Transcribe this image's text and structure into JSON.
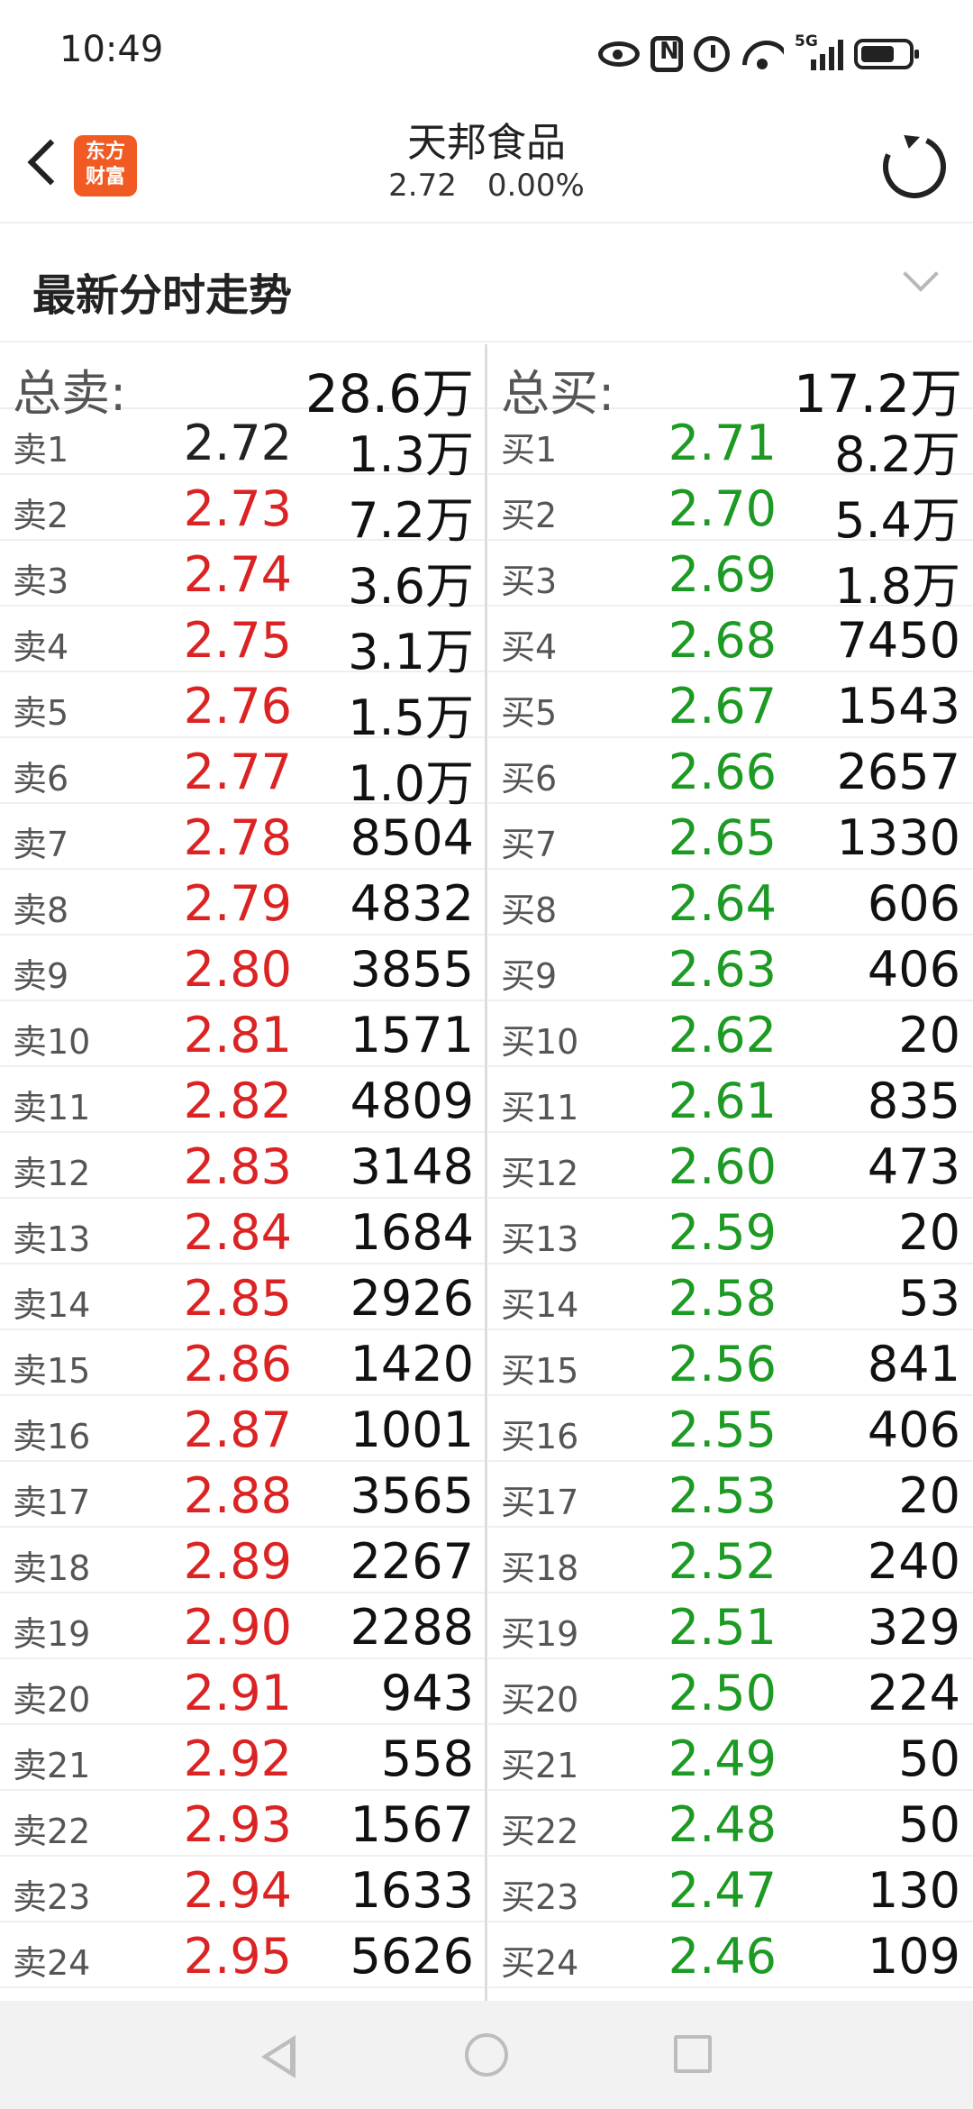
{
  "status_bar": {
    "time": "10:49",
    "network": "5G",
    "icons": [
      "eye-icon",
      "nfc-icon",
      "alarm-icon",
      "wifi-icon",
      "signal-icon",
      "battery-icon"
    ]
  },
  "header": {
    "app_logo_line1": "东方",
    "app_logo_line2": "财富",
    "stock_name": "天邦食品",
    "price": "2.72",
    "change_pct": "0.00%"
  },
  "section": {
    "title": "最新分时走势"
  },
  "order_book": {
    "sell_total_label": "总卖:",
    "sell_total": "28.6万",
    "buy_total_label": "总买:",
    "buy_total": "17.2万",
    "sell": [
      {
        "level": "卖1",
        "price": "2.72",
        "volume": "1.3万"
      },
      {
        "level": "卖2",
        "price": "2.73",
        "volume": "7.2万"
      },
      {
        "level": "卖3",
        "price": "2.74",
        "volume": "3.6万"
      },
      {
        "level": "卖4",
        "price": "2.75",
        "volume": "3.1万"
      },
      {
        "level": "卖5",
        "price": "2.76",
        "volume": "1.5万"
      },
      {
        "level": "卖6",
        "price": "2.77",
        "volume": "1.0万"
      },
      {
        "level": "卖7",
        "price": "2.78",
        "volume": "8504"
      },
      {
        "level": "卖8",
        "price": "2.79",
        "volume": "4832"
      },
      {
        "level": "卖9",
        "price": "2.80",
        "volume": "3855"
      },
      {
        "level": "卖10",
        "price": "2.81",
        "volume": "1571"
      },
      {
        "level": "卖11",
        "price": "2.82",
        "volume": "4809"
      },
      {
        "level": "卖12",
        "price": "2.83",
        "volume": "3148"
      },
      {
        "level": "卖13",
        "price": "2.84",
        "volume": "1684"
      },
      {
        "level": "卖14",
        "price": "2.85",
        "volume": "2926"
      },
      {
        "level": "卖15",
        "price": "2.86",
        "volume": "1420"
      },
      {
        "level": "卖16",
        "price": "2.87",
        "volume": "1001"
      },
      {
        "level": "卖17",
        "price": "2.88",
        "volume": "3565"
      },
      {
        "level": "卖18",
        "price": "2.89",
        "volume": "2267"
      },
      {
        "level": "卖19",
        "price": "2.90",
        "volume": "2288"
      },
      {
        "level": "卖20",
        "price": "2.91",
        "volume": "943"
      },
      {
        "level": "卖21",
        "price": "2.92",
        "volume": "558"
      },
      {
        "level": "卖22",
        "price": "2.93",
        "volume": "1567"
      },
      {
        "level": "卖23",
        "price": "2.94",
        "volume": "1633"
      },
      {
        "level": "卖24",
        "price": "2.95",
        "volume": "5626"
      }
    ],
    "buy": [
      {
        "level": "买1",
        "price": "2.71",
        "volume": "8.2万"
      },
      {
        "level": "买2",
        "price": "2.70",
        "volume": "5.4万"
      },
      {
        "level": "买3",
        "price": "2.69",
        "volume": "1.8万"
      },
      {
        "level": "买4",
        "price": "2.68",
        "volume": "7450"
      },
      {
        "level": "买5",
        "price": "2.67",
        "volume": "1543"
      },
      {
        "level": "买6",
        "price": "2.66",
        "volume": "2657"
      },
      {
        "level": "买7",
        "price": "2.65",
        "volume": "1330"
      },
      {
        "level": "买8",
        "price": "2.64",
        "volume": "606"
      },
      {
        "level": "买9",
        "price": "2.63",
        "volume": "406"
      },
      {
        "level": "买10",
        "price": "2.62",
        "volume": "20"
      },
      {
        "level": "买11",
        "price": "2.61",
        "volume": "835"
      },
      {
        "level": "买12",
        "price": "2.60",
        "volume": "473"
      },
      {
        "level": "买13",
        "price": "2.59",
        "volume": "20"
      },
      {
        "level": "买14",
        "price": "2.58",
        "volume": "53"
      },
      {
        "level": "买15",
        "price": "2.56",
        "volume": "841"
      },
      {
        "level": "买16",
        "price": "2.55",
        "volume": "406"
      },
      {
        "level": "买17",
        "price": "2.53",
        "volume": "20"
      },
      {
        "level": "买18",
        "price": "2.52",
        "volume": "240"
      },
      {
        "level": "买19",
        "price": "2.51",
        "volume": "329"
      },
      {
        "level": "买20",
        "price": "2.50",
        "volume": "224"
      },
      {
        "level": "买21",
        "price": "2.49",
        "volume": "50"
      },
      {
        "level": "买22",
        "price": "2.48",
        "volume": "50"
      },
      {
        "level": "买23",
        "price": "2.47",
        "volume": "130"
      },
      {
        "level": "买24",
        "price": "2.46",
        "volume": "109"
      }
    ]
  },
  "colors": {
    "up": "#dc2323",
    "down": "#1d9a23",
    "brand": "#f15a22"
  },
  "nav_bar": {
    "icons": [
      "nav-back-icon",
      "nav-home-icon",
      "nav-recent-icon"
    ]
  }
}
